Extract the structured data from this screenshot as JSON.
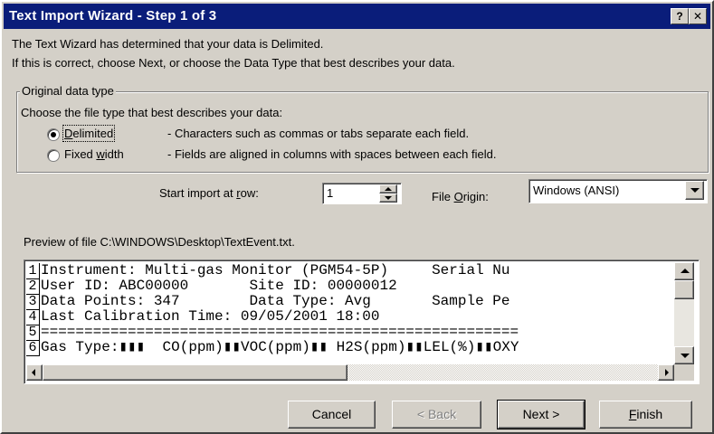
{
  "window": {
    "title": "Text Import Wizard - Step 1 of 3",
    "help_glyph": "?",
    "close_glyph": "✕"
  },
  "intro": {
    "line1": "The Text Wizard has determined that your data is Delimited.",
    "line2": "If this is correct, choose Next, or choose the Data Type that best describes your data."
  },
  "original_type": {
    "legend": "Original data type",
    "prompt": "Choose the file type that best describes your data:",
    "options": [
      {
        "label_pre": "",
        "label_key": "D",
        "label_post": "elimited",
        "description": "- Characters such as commas or tabs separate each field.",
        "selected": true
      },
      {
        "label_pre": "Fixed ",
        "label_key": "w",
        "label_post": "idth",
        "description": "- Fields are aligned in columns with spaces between each field.",
        "selected": false
      }
    ]
  },
  "start_import": {
    "label_pre": "Start import at ",
    "label_key": "r",
    "label_post": "ow:",
    "value": "1"
  },
  "file_origin": {
    "label_pre": "File ",
    "label_key": "O",
    "label_post": "rigin:",
    "value": "Windows (ANSI)"
  },
  "preview": {
    "caption": "Preview of file C:\\WINDOWS\\Desktop\\TextEvent.txt.",
    "rows": [
      {
        "num": "1",
        "text": "Instrument: Multi-gas Monitor (PGM54-5P)     Serial Nu"
      },
      {
        "num": "2",
        "text": "User ID: ABC00000       Site ID: 00000012"
      },
      {
        "num": "3",
        "text": "Data Points: 347        Data Type: Avg       Sample Pe"
      },
      {
        "num": "4",
        "text": "Last Calibration Time: 09/05/2001 18:00"
      },
      {
        "num": "5",
        "text": "======================================================="
      },
      {
        "num": "6",
        "text": "Gas Type:▮▮▮  CO(ppm)▮▮VOC(ppm)▮▮ H2S(ppm)▮▮LEL(%)▮▮OXY"
      }
    ]
  },
  "buttons": {
    "cancel": "Cancel",
    "back": "< Back",
    "next": "Next >",
    "finish_key": "F",
    "finish_rest": "inish"
  },
  "colors": {
    "titlebar": "#0a1d7a",
    "face": "#d4d0c8",
    "field": "#ffffff"
  },
  "icons": {
    "spin_up": "triangle-up",
    "spin_down": "triangle-down",
    "dropdown": "triangle-down",
    "scroll_up": "triangle-up",
    "scroll_down": "triangle-down",
    "scroll_left": "triangle-left",
    "scroll_right": "triangle-right"
  }
}
